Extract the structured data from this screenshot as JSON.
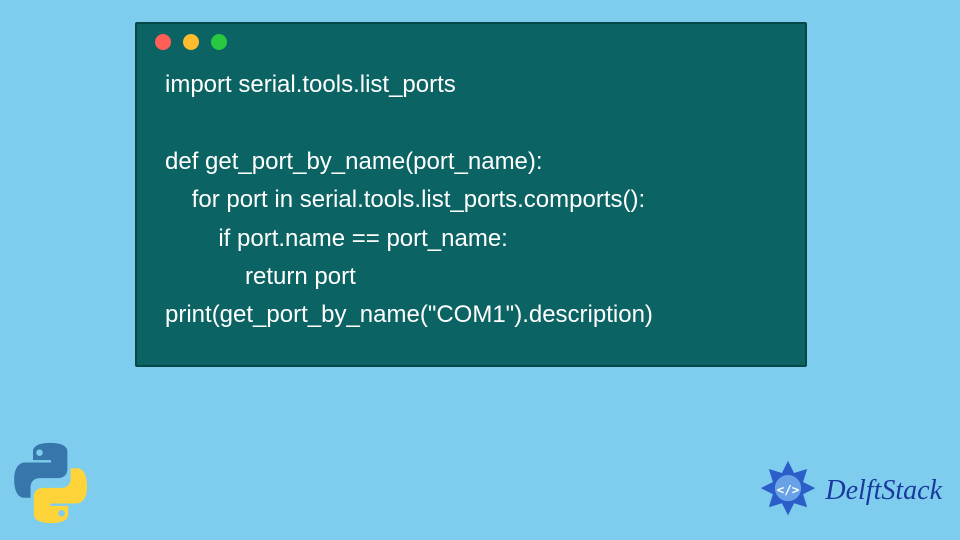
{
  "code": {
    "lines": [
      "import serial.tools.list_ports",
      "",
      "def get_port_by_name(port_name):",
      "    for port in serial.tools.list_ports.comports():",
      "        if port.name == port_name:",
      "            return port",
      "print(get_port_by_name(\"COM1\").description)"
    ]
  },
  "branding": {
    "text": "DelftStack"
  },
  "colors": {
    "background": "#7ecdee",
    "window": "#0c6363",
    "code_text": "#ffffff",
    "brand_text": "#1a3a9e"
  }
}
